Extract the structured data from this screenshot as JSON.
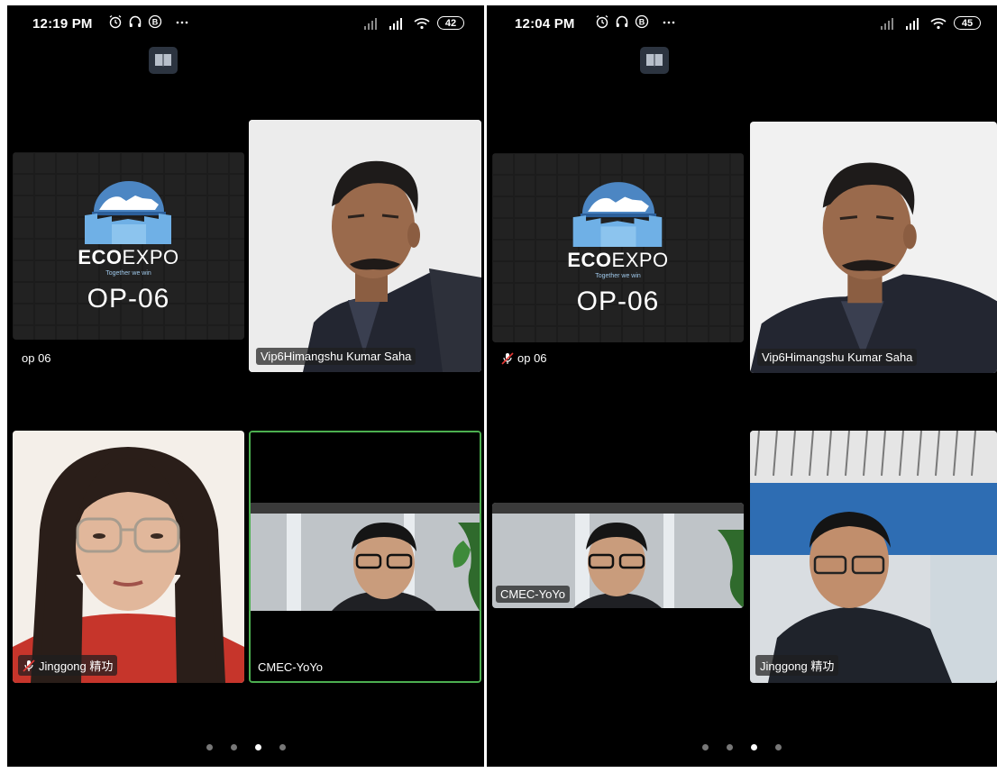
{
  "screens": [
    {
      "time": "12:19 PM",
      "battery": "42",
      "tiles": {
        "logo": {
          "brand_bold": "ECO",
          "brand_light": "EXPO",
          "tagline": "Together we win",
          "code": "OP-06",
          "name": "op 06"
        },
        "man": {
          "name": "Vip6Himangshu Kumar Saha"
        },
        "woman": {
          "name": "Jinggong 精功"
        },
        "yoyo": {
          "name": "CMEC-YoYo"
        }
      },
      "page_dots": {
        "count": 4,
        "active": 3
      }
    },
    {
      "time": "12:04 PM",
      "battery": "45",
      "tiles": {
        "logo": {
          "brand_bold": "ECO",
          "brand_light": "EXPO",
          "tagline": "Together we win",
          "code": "OP-06",
          "name": "op 06"
        },
        "man": {
          "name": "Vip6Himangshu Kumar Saha"
        },
        "yoyo": {
          "name": "CMEC-YoYo"
        },
        "jinggong": {
          "name": "Jinggong 精功"
        }
      },
      "page_dots": {
        "count": 4,
        "active": 3
      }
    }
  ],
  "colors": {
    "active_speaker_border": "#4caf50",
    "background": "#000000"
  },
  "icons": [
    "alarm-icon",
    "headphones-icon",
    "b-circle-icon",
    "more-icon",
    "signal-icon",
    "wifi-icon",
    "battery-icon",
    "book-app-icon",
    "mic-off-icon"
  ]
}
